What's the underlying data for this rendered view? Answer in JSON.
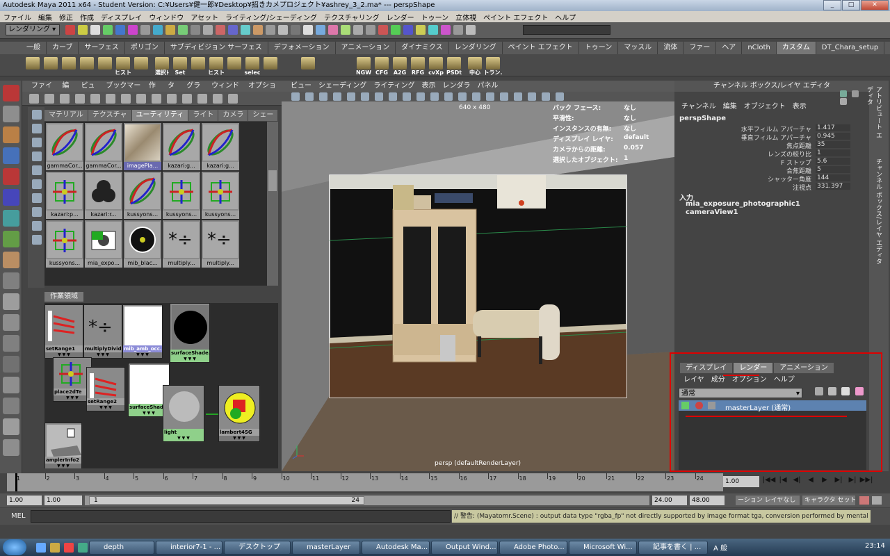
{
  "window": {
    "title": "Autodesk Maya 2011 x64 - Student Version: C:¥Users¥健一郎¥Desktop¥招きカメプロジェクト¥ashrey_3_2.ma*   ---   perspShape"
  },
  "menubar": [
    "ファイル",
    "編集",
    "修正",
    "作成",
    "ディスプレイ",
    "ウィンドウ",
    "アセット",
    "ライティング/シェーディング",
    "テクスチャリング",
    "レンダー",
    "トゥーン",
    "立体視",
    "ペイント エフェクト",
    "ヘルプ"
  ],
  "statusline": {
    "mode": "レンダリング"
  },
  "shelf_tabs": [
    "一般",
    "カーブ",
    "サーフェス",
    "ポリゴン",
    "サブディビジョン サーフェス",
    "デフォメーション",
    "アニメーション",
    "ダイナミクス",
    "レンダリング",
    "ペイント エフェクト",
    "トゥーン",
    "マッスル",
    "流体",
    "ファー",
    "ヘア",
    "nCloth",
    "カスタム",
    "DT_Chara_setup"
  ],
  "shelf_active": "カスタム",
  "shelf_buttons": [
    "ヒスト",
    "選択ﾄ",
    "Set",
    "ヒスト",
    "selec",
    "NGW",
    "CFG",
    "A2G",
    "RFG",
    "cvXp",
    "PSDt",
    "中心",
    "トラン."
  ],
  "hypershade": {
    "menus": [
      "ファイル",
      "編集",
      "ビュー",
      "ブックマーク",
      "作成",
      "タブ",
      "グラフ",
      "ウィンドウ",
      "オプション"
    ],
    "tabs": [
      "マテリアル",
      "テクスチャ",
      "ユーティリティ",
      "ライト",
      "カメラ",
      "シェー"
    ],
    "active_tab": "ユーティリティ",
    "swatches": [
      "gammaCor...",
      "gammaCor...",
      "imagePla...",
      "kazari:g...",
      "kazari:g...",
      "kazari:p...",
      "kazari:r...",
      "kussyons...",
      "kussyons...",
      "kussyons...",
      "kussyons...",
      "mia_expo...",
      "mib_blac...",
      "multiply...",
      "multiply..."
    ],
    "work_tab": "作業領域",
    "nodes": [
      "setRange1",
      "multiplyDivid...",
      "mib_amb_occ...",
      "surfaceShade...",
      "place2dTe",
      "setRange2",
      "surfaceShade...",
      "light",
      "lambert4SG",
      "amplerInfo2"
    ]
  },
  "viewport": {
    "menus": [
      "ビュー",
      "シェーディング",
      "ライティング",
      "表示",
      "レンダラ",
      "パネル"
    ],
    "resolution": "640 x 480",
    "hud": [
      {
        "k": "バック フェース:",
        "v": "なし"
      },
      {
        "k": "平滑性:",
        "v": "なし"
      },
      {
        "k": "インスタンスの有無:",
        "v": "なし"
      },
      {
        "k": "ディスプレイ レイヤ:",
        "v": "default"
      },
      {
        "k": "カメラからの距離:",
        "v": "0.057"
      },
      {
        "k": "選択したオブジェクト:",
        "v": "1"
      }
    ],
    "camera_label": "persp (defaultRenderLayer)"
  },
  "channelbox": {
    "header": "チャンネル ボックス/レイヤ エディタ",
    "menus": [
      "チャンネル",
      "編集",
      "オブジェクト",
      "表示"
    ],
    "node": "perspShape",
    "attrs": [
      {
        "n": "水平フィルム アパーチャ",
        "v": "1.417"
      },
      {
        "n": "垂直フィルム アパーチャ",
        "v": "0.945"
      },
      {
        "n": "焦点距離",
        "v": "35"
      },
      {
        "n": "レンズの絞り比",
        "v": "1"
      },
      {
        "n": "F ストップ",
        "v": "5.6"
      },
      {
        "n": "合焦距離",
        "v": "5"
      },
      {
        "n": "シャッター角度",
        "v": "144"
      },
      {
        "n": "注視点",
        "v": "331.397"
      }
    ],
    "inputs_label": "入力",
    "inputs": [
      "mia_exposure_photographic1",
      "cameraView1"
    ]
  },
  "side_tabs": [
    "アトリビュート エディタ",
    "チャンネル ボックス/レイヤ エディタ"
  ],
  "layer_editor": {
    "tabs": [
      "ディスプレイ",
      "レンダー",
      "アニメーション"
    ],
    "active_tab": "レンダー",
    "menus": [
      "レイヤ",
      "成分",
      "オプション",
      "ヘルプ"
    ],
    "mode": "通常",
    "layer": "masterLayer (通常)"
  },
  "timeline": {
    "ticks": [
      "1",
      "2",
      "3",
      "4",
      "5",
      "6",
      "7",
      "8",
      "9",
      "10",
      "11",
      "12",
      "13",
      "14",
      "15",
      "16",
      "17",
      "18",
      "19",
      "20",
      "21",
      "22",
      "23",
      "24"
    ],
    "current": "1.00"
  },
  "range": {
    "start": "1.00",
    "start2": "1.00",
    "slider_start": "1",
    "slider_end": "24",
    "end": "24.00",
    "end2": "48.00",
    "anim_layer": "ーション レイヤなし",
    "char_set": "キャラクタ セットなし"
  },
  "cmdline": {
    "label": "MEL",
    "output": "// 警告: (Mayatomr.Scene) : output data type \"rgba_fp\" not directly supported by image format tga, conversion performed by mental ray"
  },
  "taskbar": {
    "tasks": [
      "depth",
      "interior7-1 - ...",
      "デスクトップ",
      "masterLayer",
      "Autodesk Ma...",
      "Output Wind...",
      "Adobe Photo...",
      "Microsoft Wi...",
      "記事を書く | ..."
    ],
    "ime": "A 般",
    "clock": "23:14"
  }
}
